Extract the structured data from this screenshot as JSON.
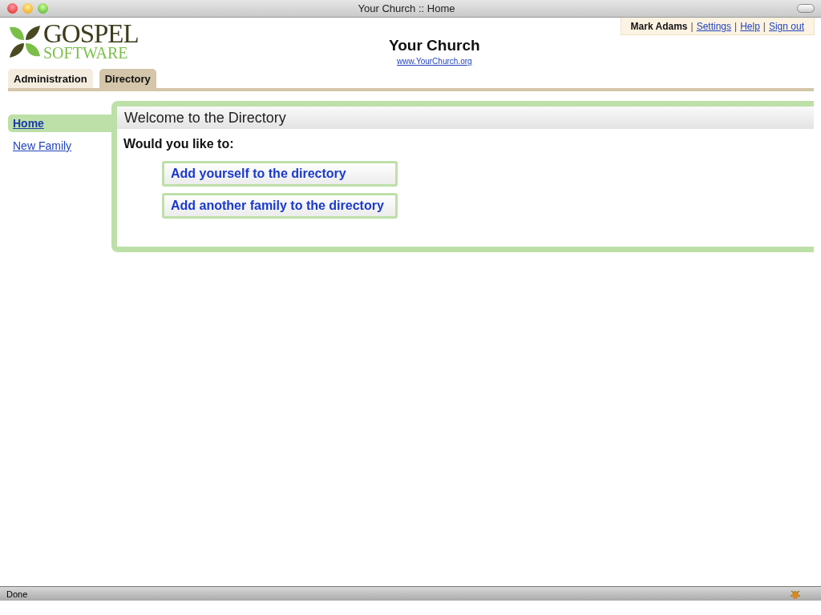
{
  "window": {
    "title": "Your Church :: Home"
  },
  "logo": {
    "line_1": "GOSPEL",
    "line_2": "SOFTWARE"
  },
  "site": {
    "name": "Your Church",
    "url": "www.YourChurch.org"
  },
  "user_bar": {
    "user": "Mark Adams",
    "links": [
      "Settings",
      "Help",
      "Sign out"
    ],
    "separators": [
      "|",
      "|",
      "|"
    ]
  },
  "tabs": [
    {
      "label": "Administration",
      "selected": false
    },
    {
      "label": "Directory",
      "selected": true
    }
  ],
  "sidebar": {
    "items": [
      {
        "label": "Home",
        "selected": true
      },
      {
        "label": "New Family",
        "selected": false
      }
    ]
  },
  "panel": {
    "title": "Welcome to the Directory",
    "prompt": "Would you like to:",
    "actions": [
      "Add yourself to the directory",
      "Add another family to the directory"
    ]
  },
  "status_bar": {
    "text": "Done"
  }
}
